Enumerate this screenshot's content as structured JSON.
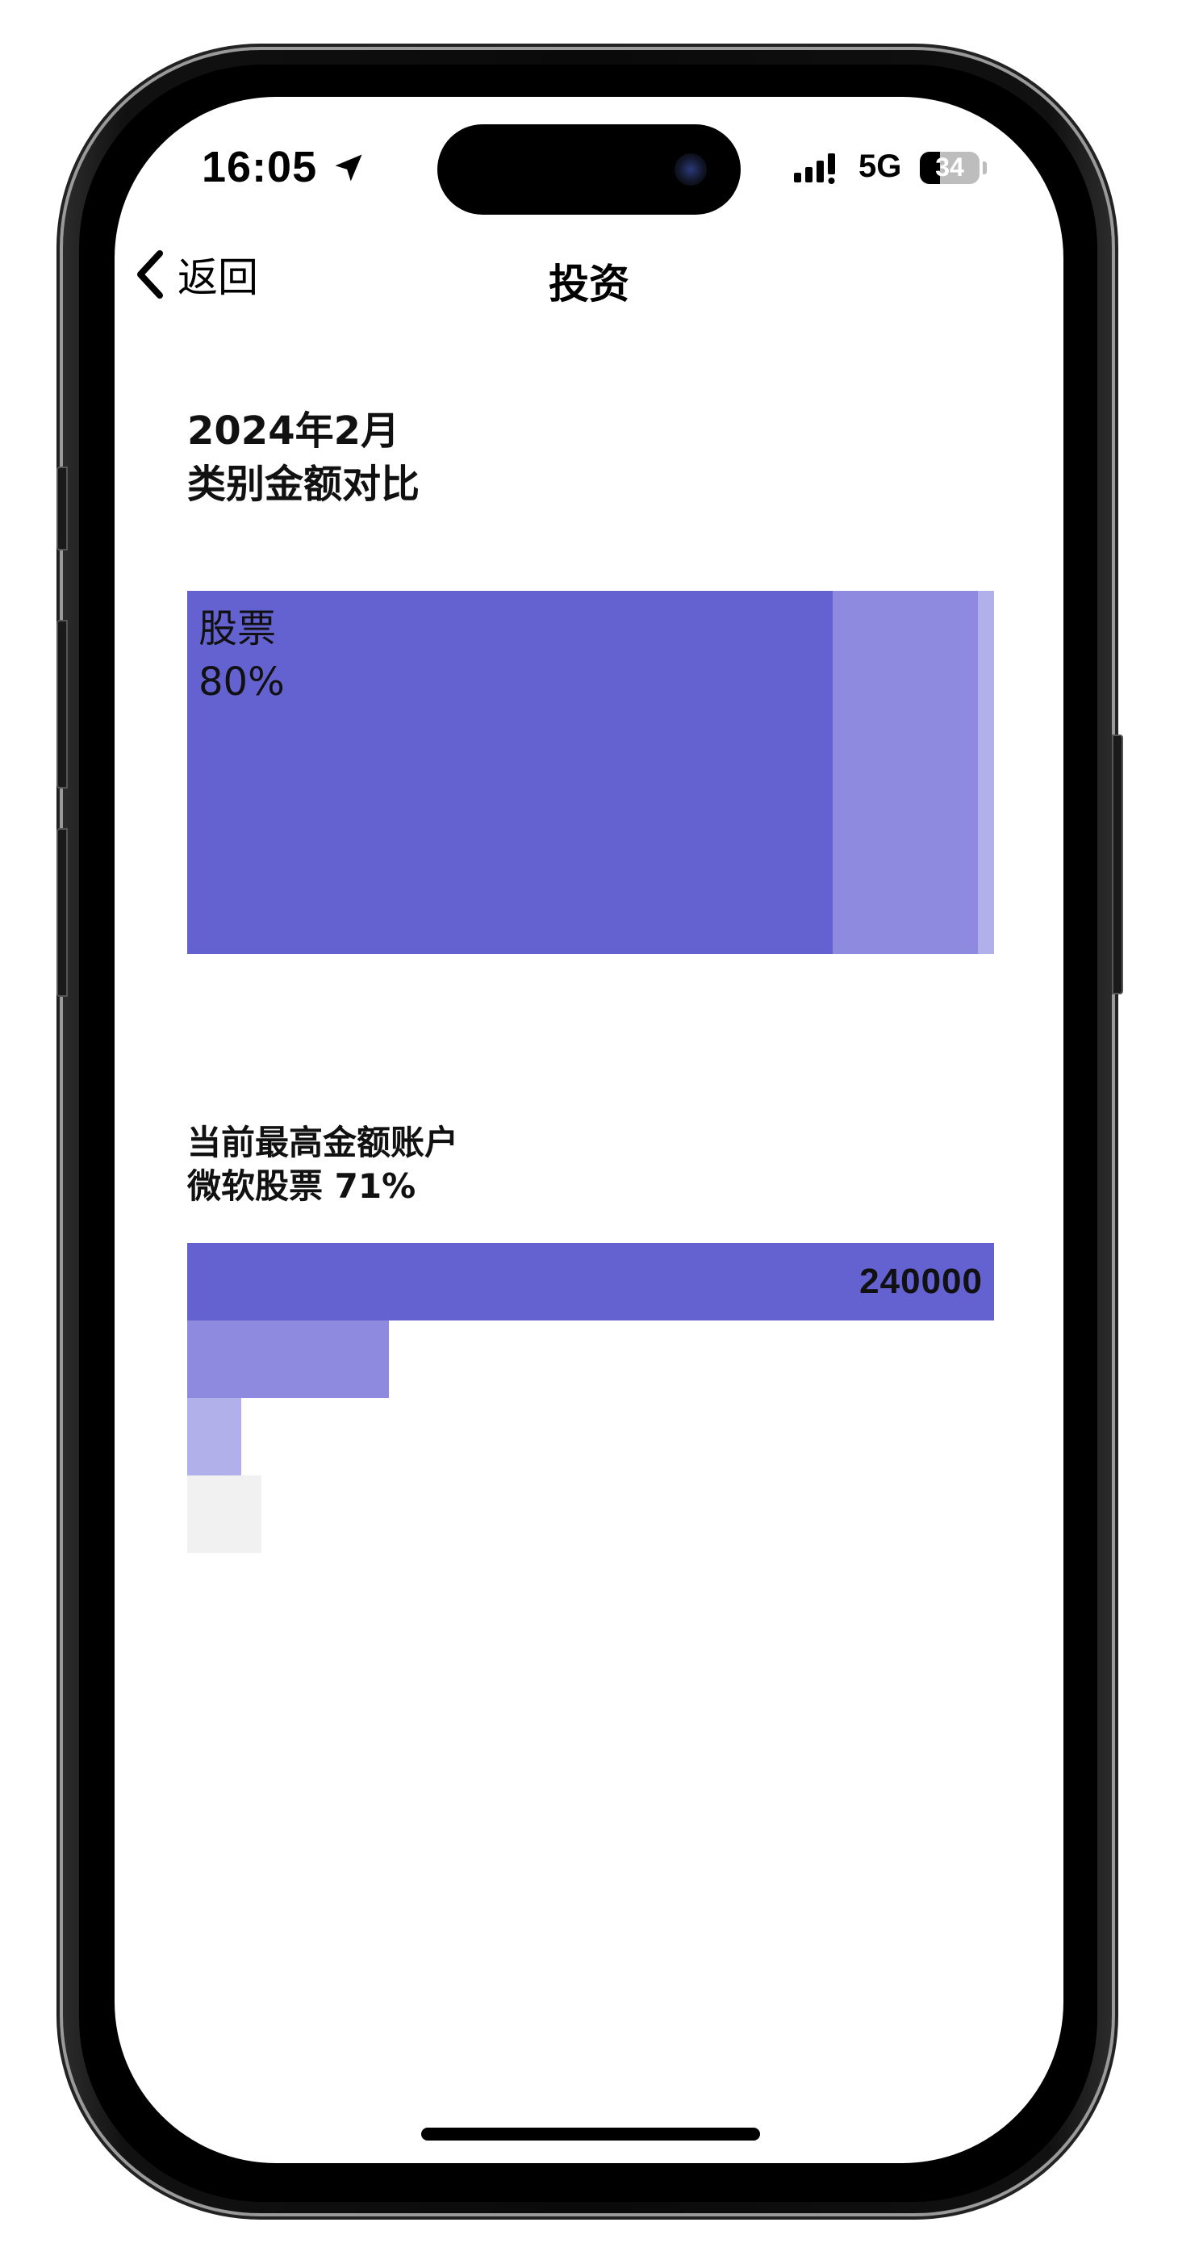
{
  "status_bar": {
    "time": "16:05",
    "network": "5G",
    "battery_level": "34",
    "battery_percent": 34
  },
  "nav": {
    "back_label": "返回",
    "title": "投资"
  },
  "section1": {
    "period": "2024年2月",
    "subtitle": "类别金额对比",
    "treemap": [
      {
        "label": "股票",
        "percent_label": "80%",
        "share": 0.8,
        "color": "#6462d0"
      },
      {
        "share": 0.18,
        "color": "#8d8adf"
      },
      {
        "share": 0.02,
        "color": "#b2b0ea"
      }
    ]
  },
  "section2": {
    "heading": "当前最高金额账户",
    "top_account": "微软股票 71%",
    "bars": [
      {
        "value": 240000,
        "value_label": "240000",
        "color": "#6462d0"
      },
      {
        "value": 60000,
        "color": "#8d8adf"
      },
      {
        "value": 16000,
        "color": "#b2b0ea"
      },
      {
        "value": 22000,
        "color": "#f1f1f1"
      }
    ]
  },
  "colors": {
    "accent": "#6462d0",
    "accent_light": "#8d8adf",
    "accent_lighter": "#b2b0ea",
    "empty": "#f1f1f1"
  }
}
